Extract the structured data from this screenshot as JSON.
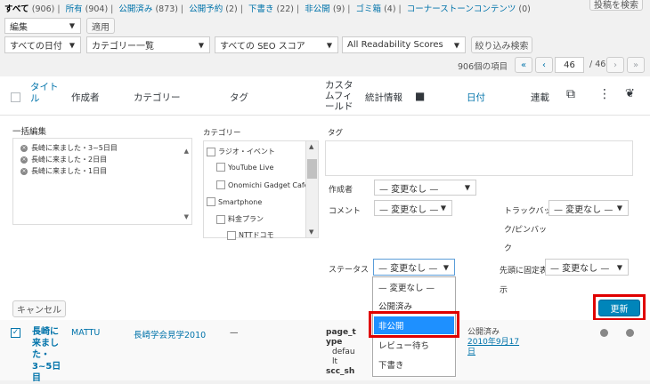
{
  "filters": {
    "all": {
      "label": "すべて",
      "count": "(906)"
    },
    "mine": {
      "label": "所有",
      "count": "(904)"
    },
    "published": {
      "label": "公開済み",
      "count": "(873)"
    },
    "scheduled": {
      "label": "公開予約",
      "count": "(2)"
    },
    "drafts": {
      "label": "下書き",
      "count": "(22)"
    },
    "private": {
      "label": "非公開",
      "count": "(9)"
    },
    "trash": {
      "label": "ゴミ箱",
      "count": "(4)"
    },
    "cornerstone": {
      "label": "コーナーストーンコンテンツ",
      "count": "(0)"
    }
  },
  "search_button": "投稿を検索",
  "bulk": {
    "action_value": "編集",
    "apply_label": "適用"
  },
  "toolbar": {
    "date_filter": "すべての日付",
    "category_filter": "カテゴリー一覧",
    "seo_filter": "すべての SEO スコア",
    "readability_filter": "All Readability Scores",
    "filter_button": "絞り込み検索"
  },
  "pagination": {
    "items_text": "906個の項目",
    "first": "«",
    "prev": "‹",
    "current": "46",
    "total": "/ 46",
    "next": "›",
    "last": "»"
  },
  "columns": {
    "title": "タイトル",
    "author": "作成者",
    "categories": "カテゴリー",
    "tags": "タグ",
    "custom_fields": "カスタムフィールド",
    "stats": "統計情報",
    "date": "日付",
    "serial": "連載"
  },
  "bulk_edit": {
    "heading": "一括編集",
    "posts": [
      "長崎に来ました・3~5日目",
      "長崎に来ました・2日目",
      "長崎に来ました・1日目"
    ],
    "categories_label": "カテゴリー",
    "categories": [
      "ラジオ・イベント",
      "YouTube Live",
      "Onomichi Gadget Cafe",
      "Smartphone",
      "料金プラン",
      "NTTドコモ"
    ],
    "tags_label": "タグ",
    "author_label": "作成者",
    "author_value": "— 変更なし —",
    "comments_label": "コメント",
    "comments_value": "— 変更なし —",
    "trackback_label_1": "トラックバッ",
    "trackback_label_2": "ク/ピンバッ",
    "trackback_label_3": "ク",
    "trackback_value": "— 変更なし —",
    "status_label": "ステータス",
    "status_value": "— 変更なし —",
    "sticky_label_1": "先頭に固定表",
    "sticky_label_2": "示",
    "sticky_value": "— 変更なし —",
    "cancel_label": "キャンセル",
    "update_label": "更新",
    "status_options": [
      "— 変更なし —",
      "公開済み",
      "非公開",
      "レビュー待ち",
      "下書き"
    ],
    "selected_option": "非公開"
  },
  "post_row": {
    "title_lines": [
      "長崎に",
      "来まし",
      "た・",
      "3~5日",
      "目"
    ],
    "author": "MATTU",
    "category": "長崎学会見学2010",
    "tags": "—",
    "custom_field_lines": [
      "page_t",
      "ype"
    ],
    "custom_field_values": [
      "defau",
      "lt"
    ],
    "custom_field_more": "scc_sh",
    "status": "公開済み",
    "date_1": "2010年9月17",
    "date_2": "日"
  },
  "colors": {
    "accent": "#0073aa",
    "highlight": "#1e90ff",
    "annotation": "#e00000",
    "primary_button": "#0085ba"
  }
}
